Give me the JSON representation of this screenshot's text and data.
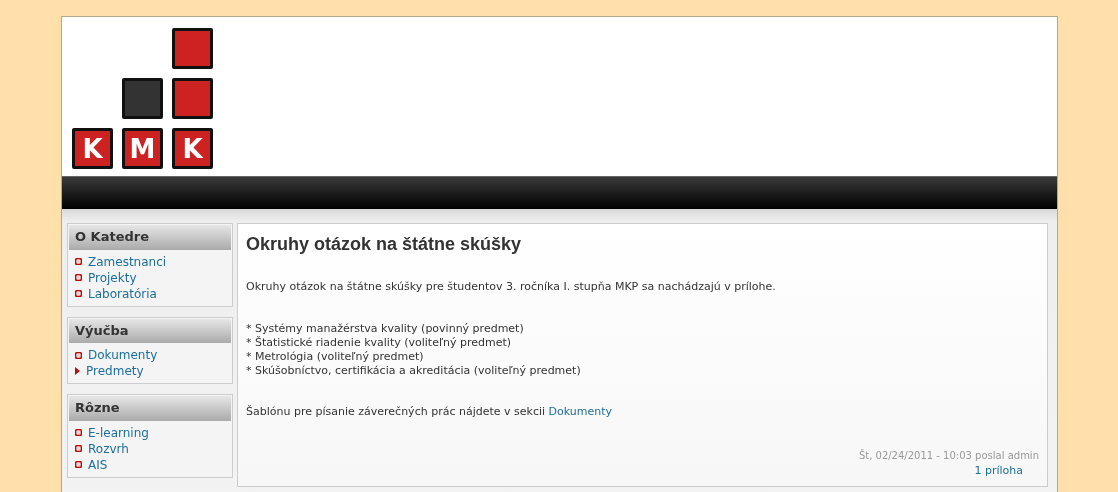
{
  "logo": {
    "letters": [
      "K",
      "M",
      "K"
    ]
  },
  "sidebar": {
    "blocks": [
      {
        "title": "O Katedre",
        "items": [
          {
            "label": "Zamestnanci",
            "kind": "leaf"
          },
          {
            "label": "Projekty",
            "kind": "leaf"
          },
          {
            "label": "Laboratória",
            "kind": "leaf"
          }
        ]
      },
      {
        "title": "Výučba",
        "items": [
          {
            "label": "Dokumenty",
            "kind": "leaf"
          },
          {
            "label": "Predmety",
            "kind": "collapsed"
          }
        ]
      },
      {
        "title": "Rôzne",
        "items": [
          {
            "label": "E-learning",
            "kind": "leaf"
          },
          {
            "label": "Rozvrh",
            "kind": "leaf"
          },
          {
            "label": "AIS",
            "kind": "leaf"
          }
        ]
      }
    ]
  },
  "article": {
    "title": "Okruhy otázok na štátne skúšky",
    "intro": "Okruhy otázok na štátne skúšky pre študentov 3. ročníka I. stupňa MKP sa nachádzajú v prílohe.",
    "list": [
      "* Systémy manažérstva kvality (povinný predmet)",
      "* Štatistické riadenie kvality (voliteľný predmet)",
      "* Metrológia (voliteľný predmet)",
      "* Skúšobníctvo, certifikácia a akreditácia (voliteľný predmet)"
    ],
    "note": "Šablónu pre písanie záverečných prác nájdete v sekcii",
    "note_link": "Dokumenty",
    "submitted": "Št, 02/24/2011 - 10:03 poslal admin",
    "attachments_link": "1 príloha"
  }
}
